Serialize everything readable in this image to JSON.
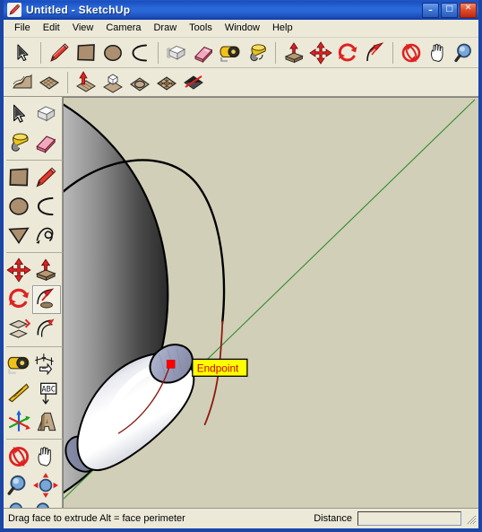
{
  "window": {
    "title": "Untitled - SketchUp",
    "app_icon": "sketchup-pencil-icon",
    "controls": {
      "minimize_label": "–",
      "maximize_label": "□",
      "close_label": "✕"
    },
    "title_bar_color": "#2a68d8",
    "border_color": "#1c45a8"
  },
  "menu": {
    "items": [
      {
        "label": "File"
      },
      {
        "label": "Edit"
      },
      {
        "label": "View"
      },
      {
        "label": "Camera"
      },
      {
        "label": "Draw"
      },
      {
        "label": "Tools"
      },
      {
        "label": "Window"
      },
      {
        "label": "Help"
      }
    ]
  },
  "toolbar_top": {
    "groups": [
      {
        "icons": [
          {
            "name": "select-arrow-icon",
            "tip": "Select"
          },
          {
            "name": "line-pencil-icon",
            "tip": "Line"
          },
          {
            "name": "rectangle-icon",
            "tip": "Rectangle"
          },
          {
            "name": "circle-icon",
            "tip": "Circle"
          },
          {
            "name": "arc-icon",
            "tip": "Arc"
          }
        ]
      },
      {
        "icons": [
          {
            "name": "make-component-icon",
            "tip": "Make Component"
          },
          {
            "name": "eraser-icon",
            "tip": "Eraser"
          },
          {
            "name": "tape-measure-icon",
            "tip": "Tape Measure"
          },
          {
            "name": "paint-bucket-icon",
            "tip": "Paint Bucket"
          }
        ]
      },
      {
        "icons": [
          {
            "name": "push-pull-icon",
            "tip": "Push/Pull"
          },
          {
            "name": "move-icon",
            "tip": "Move"
          },
          {
            "name": "rotate-icon",
            "tip": "Rotate"
          },
          {
            "name": "follow-me-icon",
            "tip": "Follow Me"
          }
        ]
      },
      {
        "icons": [
          {
            "name": "orbit-icon",
            "tip": "Orbit"
          },
          {
            "name": "pan-hand-icon",
            "tip": "Pan"
          },
          {
            "name": "zoom-magnifier-icon",
            "tip": "Zoom"
          }
        ]
      }
    ]
  },
  "toolbar_second": {
    "groups": [
      {
        "icons": [
          {
            "name": "sandbox-from-contours-icon",
            "tip": "From Contours"
          },
          {
            "name": "sandbox-from-scratch-icon",
            "tip": "From Scratch"
          }
        ]
      },
      {
        "icons": [
          {
            "name": "smoove-icon",
            "tip": "Smoove"
          },
          {
            "name": "stamp-icon",
            "tip": "Stamp"
          },
          {
            "name": "drape-icon",
            "tip": "Drape"
          },
          {
            "name": "add-detail-icon",
            "tip": "Add Detail"
          },
          {
            "name": "flip-edge-icon",
            "tip": "Flip Edge"
          }
        ]
      }
    ]
  },
  "left_toolbar": {
    "groups": [
      {
        "icons": [
          {
            "name": "select-arrow-icon",
            "tip": "Select"
          },
          {
            "name": "make-component-icon",
            "tip": "Make Component"
          },
          {
            "name": "paint-bucket-icon",
            "tip": "Paint Bucket"
          },
          {
            "name": "eraser-icon",
            "tip": "Eraser"
          }
        ]
      },
      {
        "icons": [
          {
            "name": "rectangle-icon",
            "tip": "Rectangle"
          },
          {
            "name": "line-pencil-icon",
            "tip": "Line"
          },
          {
            "name": "circle-icon",
            "tip": "Circle"
          },
          {
            "name": "arc-icon",
            "tip": "Arc"
          },
          {
            "name": "polygon-icon",
            "tip": "Polygon"
          },
          {
            "name": "freehand-icon",
            "tip": "Freehand"
          }
        ]
      },
      {
        "icons": [
          {
            "name": "move-icon",
            "tip": "Move"
          },
          {
            "name": "push-pull-icon",
            "tip": "Push/Pull"
          },
          {
            "name": "rotate-icon",
            "tip": "Rotate"
          },
          {
            "name": "follow-me-icon",
            "tip": "Follow Me",
            "selected": true
          },
          {
            "name": "scale-icon",
            "tip": "Scale"
          },
          {
            "name": "offset-icon",
            "tip": "Offset"
          }
        ]
      },
      {
        "icons": [
          {
            "name": "tape-measure-icon",
            "tip": "Tape Measure"
          },
          {
            "name": "dimension-icon",
            "tip": "Dimensions"
          },
          {
            "name": "protractor-icon",
            "tip": "Protractor"
          },
          {
            "name": "text-label-icon",
            "tip": "Text"
          },
          {
            "name": "axes-icon",
            "tip": "Axes"
          },
          {
            "name": "3d-text-icon",
            "tip": "3D Text"
          }
        ]
      },
      {
        "icons": [
          {
            "name": "orbit-icon",
            "tip": "Orbit"
          },
          {
            "name": "pan-hand-icon",
            "tip": "Pan"
          },
          {
            "name": "zoom-magnifier-icon",
            "tip": "Zoom"
          },
          {
            "name": "zoom-window-icon",
            "tip": "Zoom Window"
          },
          {
            "name": "previous-view-icon",
            "tip": "Previous"
          },
          {
            "name": "next-view-icon",
            "tip": "Next"
          }
        ]
      }
    ]
  },
  "canvas": {
    "background_color": "#d1cfb7",
    "axis_green_color": "#2e8b2e",
    "edge_black_color": "#000000",
    "path_red_color": "#8b1a0f",
    "tube_cap_color": "#9aa0bd",
    "tube_body_light": "#ffffff",
    "tube_body_shadow": "#6e7288",
    "sphere_dark": "#2a2a2a",
    "sphere_light": "#d8d8d8",
    "tooltip": {
      "text": "Endpoint",
      "background_color": "#ffff00",
      "text_color": "#cc0000",
      "border_color": "#000000"
    },
    "inference_point_color": "#ff0000"
  },
  "status_bar": {
    "message": "Drag face to extrude  Alt = face perimeter",
    "distance_label": "Distance",
    "distance_value": "",
    "distance_placeholder": ""
  }
}
